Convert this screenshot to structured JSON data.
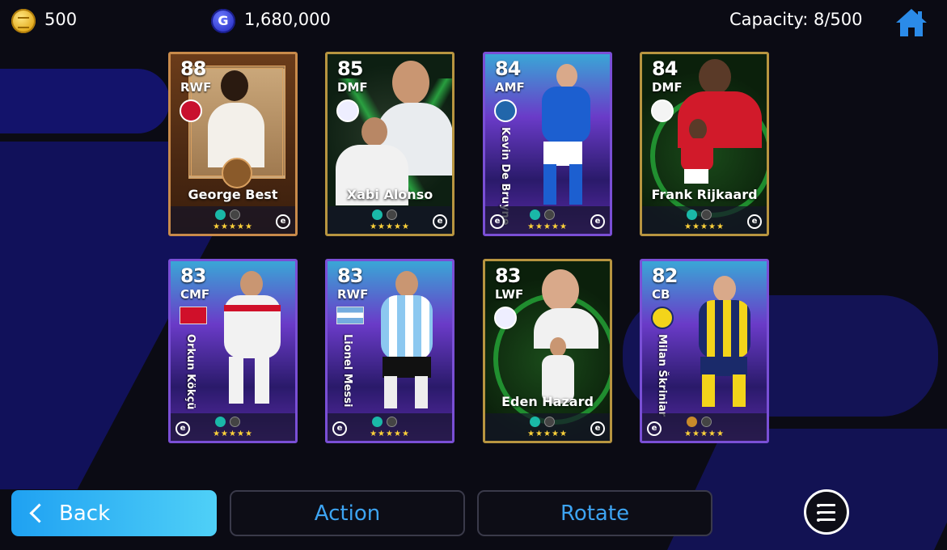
{
  "currency": {
    "coins": "500",
    "gp": "1,680,000",
    "gp_symbol": "G"
  },
  "capacity": "Capacity: 8/500",
  "cards": [
    {
      "rating": "88",
      "position": "RWF",
      "name": "George Best"
    },
    {
      "rating": "85",
      "position": "DMF",
      "name": "Xabi Alonso"
    },
    {
      "rating": "84",
      "position": "AMF",
      "name": "Kevin De Bruyne"
    },
    {
      "rating": "84",
      "position": "DMF",
      "name": "Frank Rijkaard"
    },
    {
      "rating": "83",
      "position": "CMF",
      "name": "Orkun Kökçü"
    },
    {
      "rating": "83",
      "position": "RWF",
      "name": "Lionel Messi"
    },
    {
      "rating": "83",
      "position": "LWF",
      "name": "Eden Hazard"
    },
    {
      "rating": "82",
      "position": "CB",
      "name": "Milan Škriniar"
    }
  ],
  "stars": "★★★★★",
  "buttons": {
    "back": "Back",
    "action": "Action",
    "rotate": "Rotate"
  },
  "colors": {
    "accent_blue": "#3da4f2",
    "back_gradient_start": "#1fa1f2",
    "star_gold": "#ffd23a"
  }
}
